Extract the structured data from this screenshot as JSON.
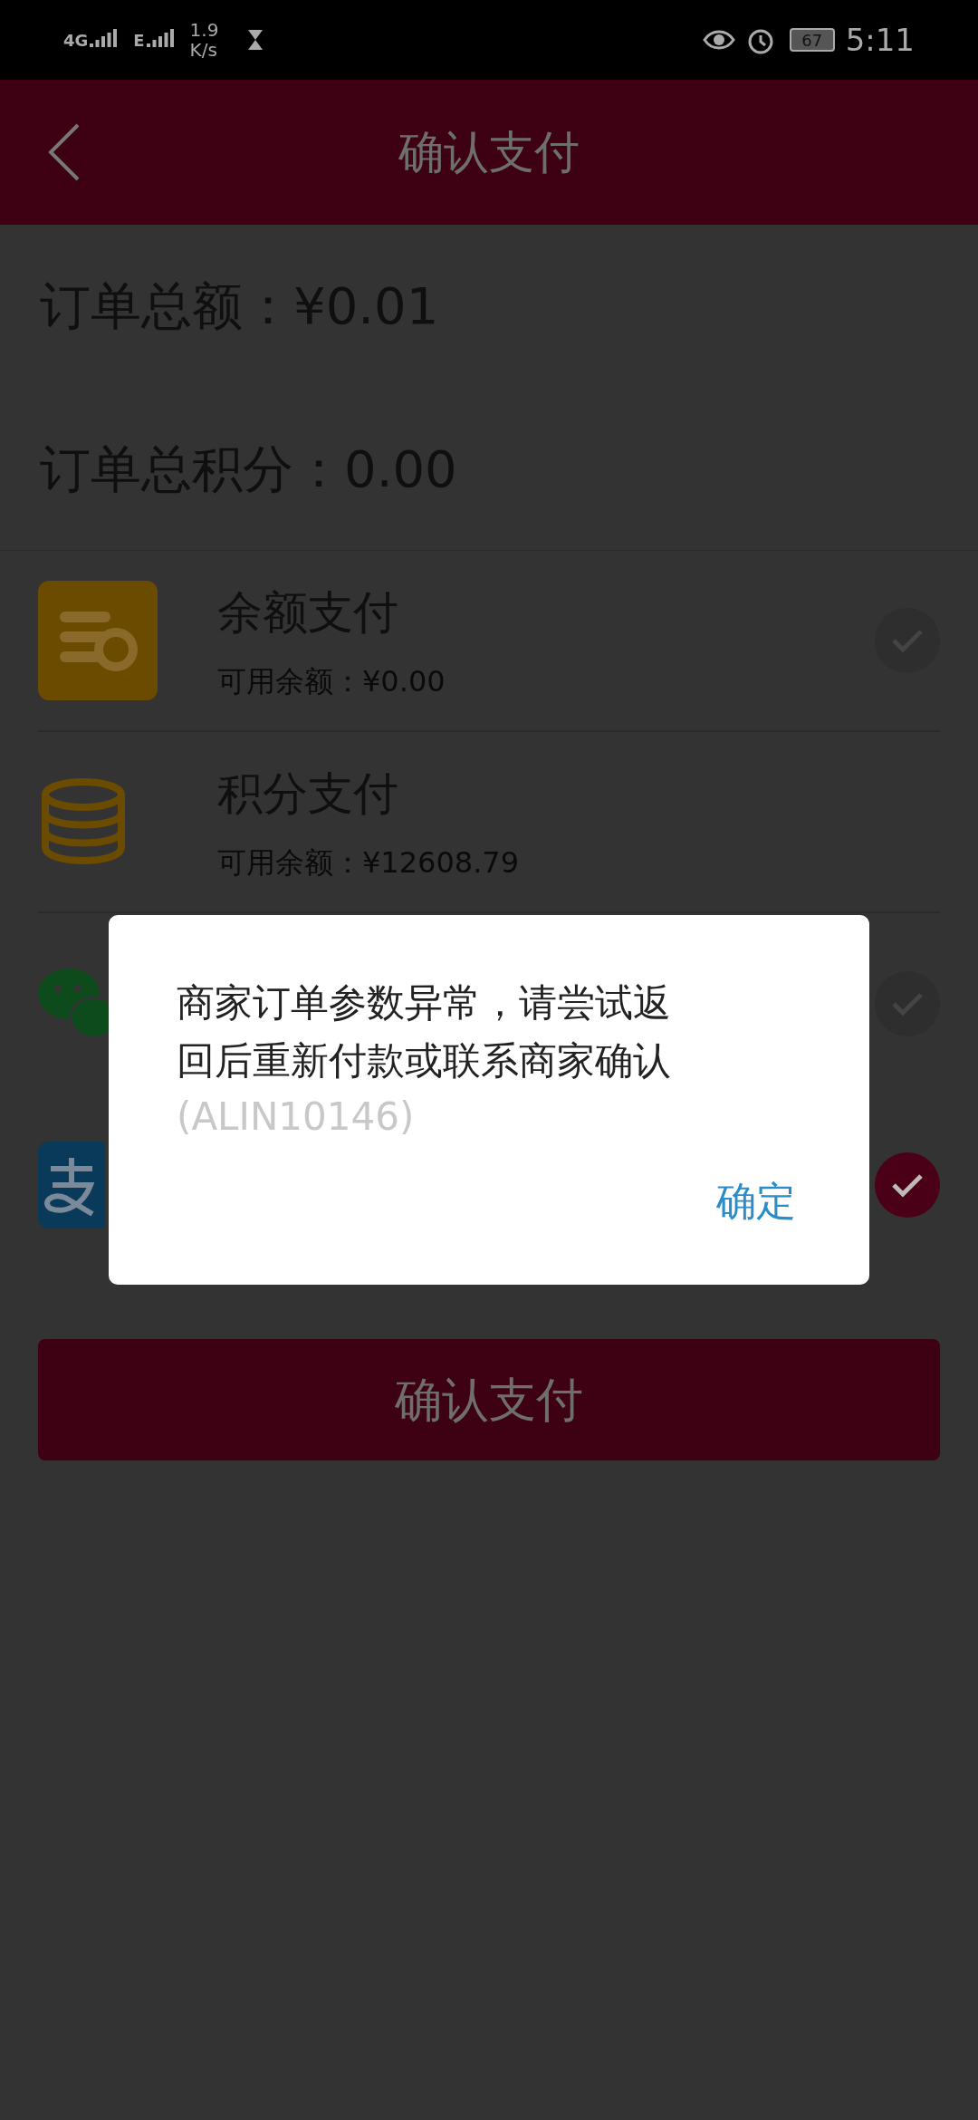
{
  "status_bar": {
    "network_1": "4G",
    "network_2": "E",
    "speed_value": "1.9",
    "speed_unit": "K/s",
    "battery": "67",
    "time": "5:11"
  },
  "header": {
    "title": "确认支付"
  },
  "order_total": {
    "label": "订单总额：",
    "value": "¥0.01"
  },
  "order_points": {
    "label": "订单总积分：",
    "value": "0.00"
  },
  "methods": [
    {
      "kind": "balance",
      "title": "余额支付",
      "subtitle": "可用余额：¥0.00",
      "selected": false
    },
    {
      "kind": "points",
      "title": "积分支付",
      "subtitle": "可用余额：¥12608.79"
    },
    {
      "kind": "wechat",
      "selected": false
    },
    {
      "kind": "alipay",
      "selected": true
    }
  ],
  "pay_button": "确认支付",
  "dialog": {
    "message": "商家订单参数异常，请尝试返回后重新付款或联系商家确认",
    "code": "(ALIN10146)",
    "ok": "确定"
  }
}
